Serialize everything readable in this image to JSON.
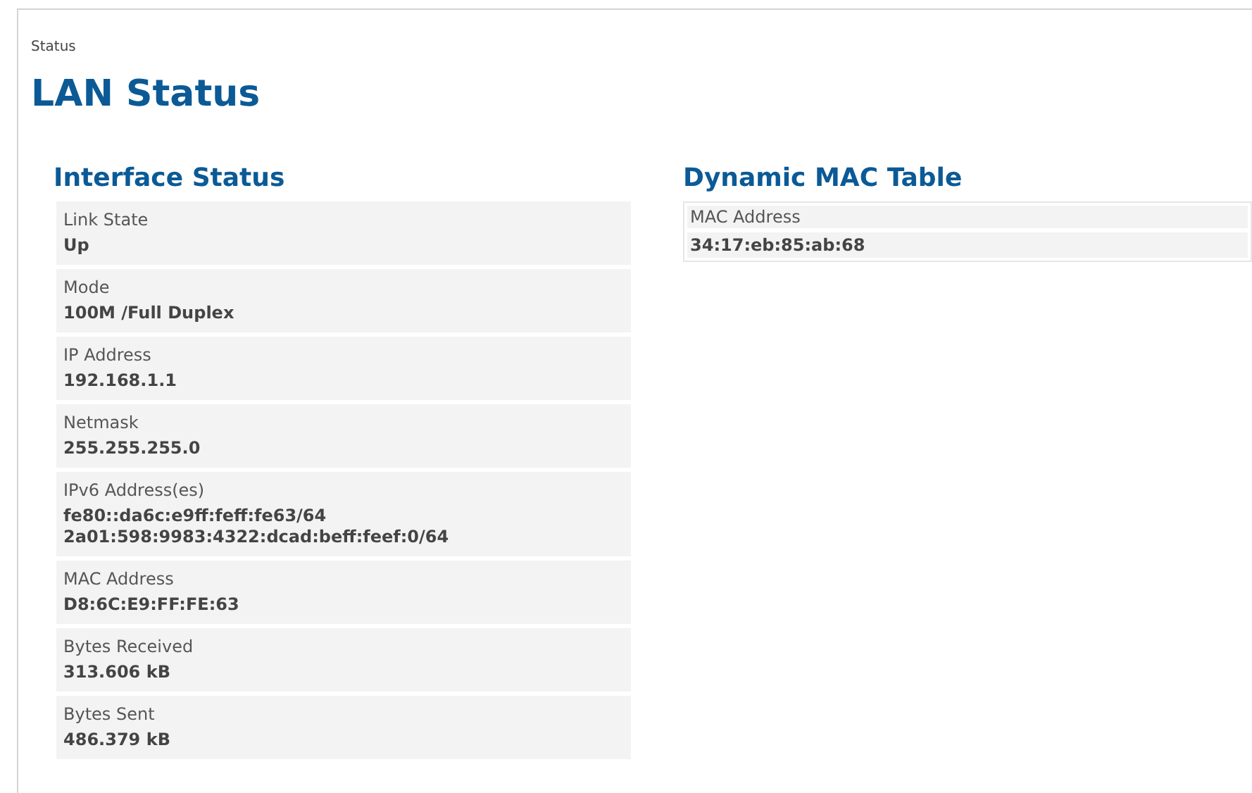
{
  "breadcrumb": "Status",
  "title": "LAN Status",
  "interface_status": {
    "heading": "Interface Status",
    "items": [
      {
        "label": "Link State",
        "values": [
          "Up"
        ]
      },
      {
        "label": "Mode",
        "values": [
          "100M /Full Duplex"
        ]
      },
      {
        "label": "IP Address",
        "values": [
          "192.168.1.1"
        ]
      },
      {
        "label": "Netmask",
        "values": [
          "255.255.255.0"
        ]
      },
      {
        "label": "IPv6 Address(es)",
        "values": [
          "fe80::da6c:e9ff:feff:fe63/64",
          "2a01:598:9983:4322:dcad:beff:feef:0/64"
        ]
      },
      {
        "label": "MAC Address",
        "values": [
          "D8:6C:E9:FF:FE:63"
        ]
      },
      {
        "label": "Bytes Received",
        "values": [
          "313.606 kB"
        ]
      },
      {
        "label": "Bytes Sent",
        "values": [
          "486.379 kB"
        ]
      }
    ]
  },
  "dynamic_mac_table": {
    "heading": "Dynamic MAC Table",
    "columns": [
      "MAC Address"
    ],
    "rows": [
      [
        "34:17:eb:85:ab:68"
      ]
    ]
  }
}
